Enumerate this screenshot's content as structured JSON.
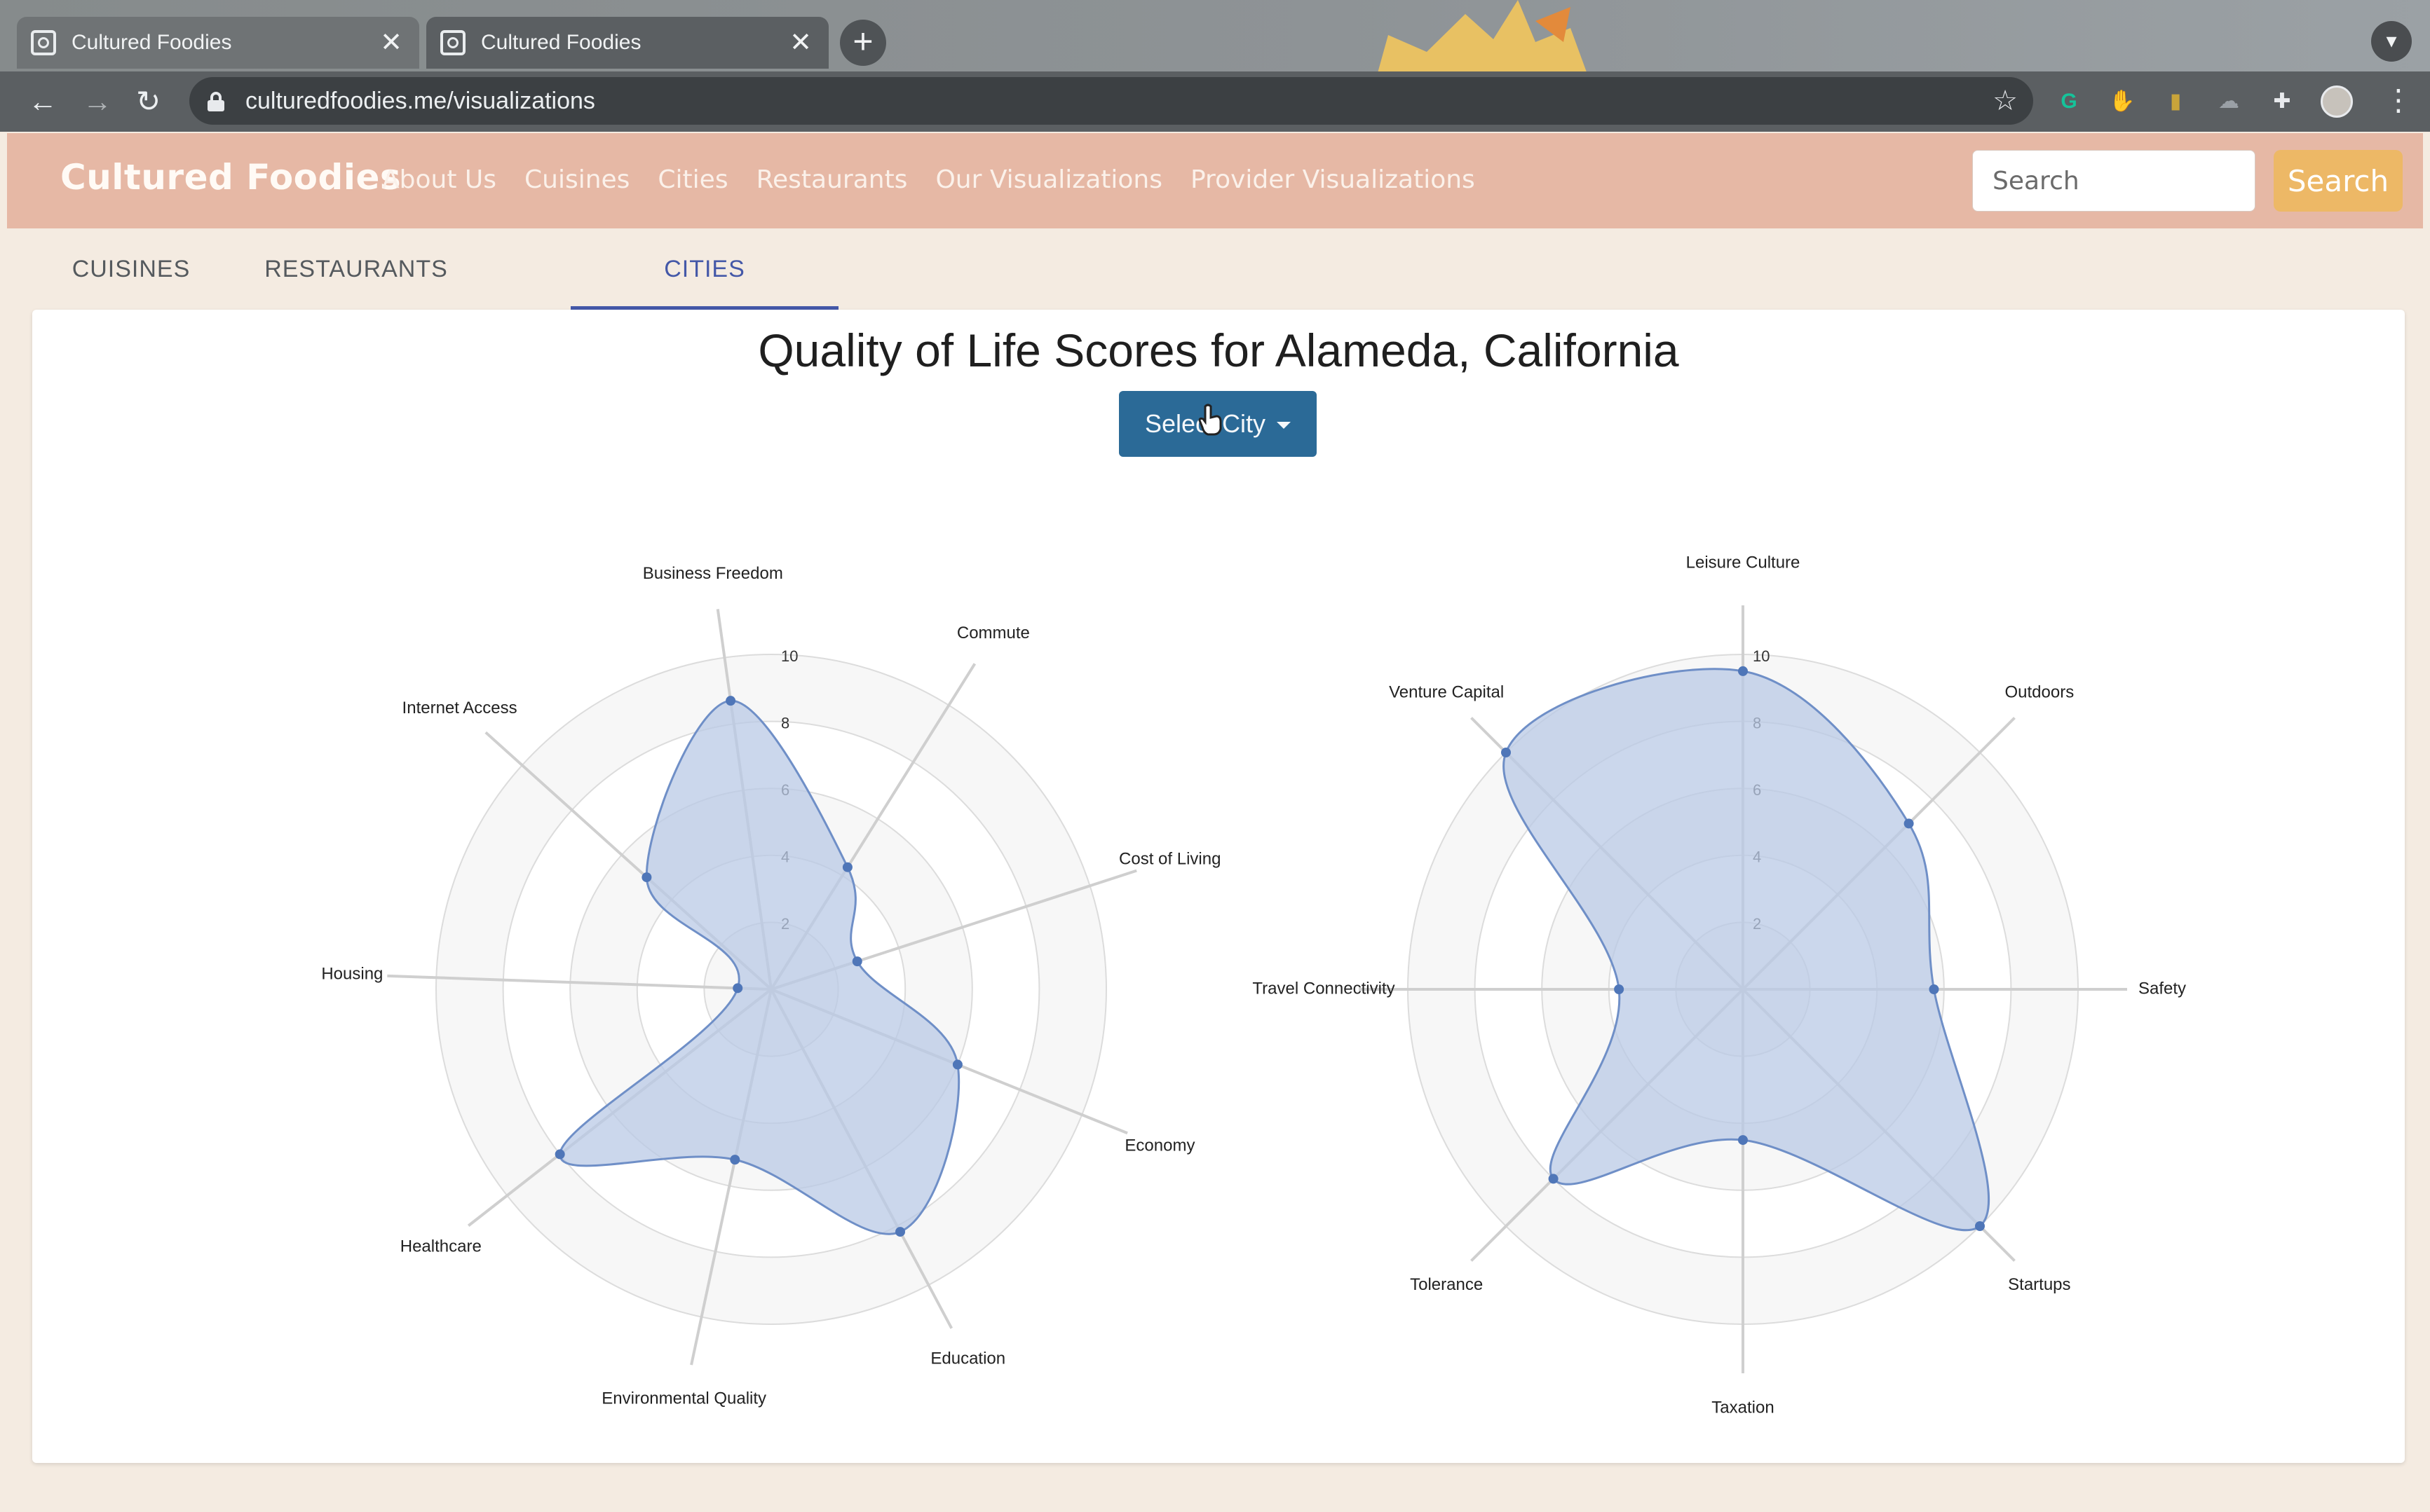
{
  "browser": {
    "tabs": [
      {
        "title": "Cultured Foodies",
        "close": "✕"
      },
      {
        "title": "Cultured Foodies",
        "close": "✕"
      }
    ],
    "new_tab": "+",
    "url": "culturedfoodies.me/visualizations",
    "nav": {
      "back": "←",
      "forward": "→",
      "reload": "↻",
      "star": "☆",
      "menu": "⋮"
    },
    "extensions": [
      {
        "icon": "grammarly-icon",
        "glyph": "G",
        "color": "#15c39a"
      },
      {
        "icon": "stop-extension-icon",
        "glyph": "✋",
        "color": "#d9442e"
      },
      {
        "icon": "highlighter-extension-icon",
        "glyph": "▮",
        "color": "#c9a43a"
      },
      {
        "icon": "cloud-extension-icon",
        "glyph": "☁",
        "color": "#9aa0a6"
      },
      {
        "icon": "puzzle-extensions-icon",
        "glyph": "✚",
        "color": "#e8eaed"
      }
    ]
  },
  "site": {
    "brand": "Cultured Foodies",
    "nav_links": [
      "About Us",
      "Cuisines",
      "Cities",
      "Restaurants",
      "Our Visualizations",
      "Provider Visualizations"
    ],
    "search_placeholder": "Search",
    "search_button": "Search"
  },
  "vis_tabs": [
    "CUISINES",
    "RESTAURANTS",
    "CITIES"
  ],
  "active_tab": "CITIES",
  "card": {
    "title": "Quality of Life Scores for Alameda, California",
    "select_button": "Select City"
  },
  "colors": {
    "accent": "#4458a8",
    "fill": "#b9cae6",
    "stroke": "#6f8fc7",
    "point": "#4f76b8"
  },
  "chart_data": [
    {
      "type": "radar",
      "title": "",
      "range": [
        0,
        10
      ],
      "ticks": [
        2,
        4,
        6,
        8,
        10
      ],
      "categories": [
        "Business Freedom",
        "Commute",
        "Cost of Living",
        "Economy",
        "Education",
        "Environmental Quality",
        "Healthcare",
        "Housing",
        "Internet Access"
      ],
      "values": [
        8.7,
        4.3,
        2.7,
        6.0,
        8.2,
        5.2,
        8.0,
        1.0,
        5.0
      ]
    },
    {
      "type": "radar",
      "title": "",
      "range": [
        0,
        10
      ],
      "ticks": [
        2,
        4,
        6,
        8,
        10
      ],
      "categories": [
        "Leisure Culture",
        "Outdoors",
        "Safety",
        "Startups",
        "Taxation",
        "Tolerance",
        "Travel Connectivity",
        "Venture Capital"
      ],
      "values": [
        9.5,
        7.0,
        5.7,
        10.0,
        4.5,
        8.0,
        3.7,
        10.0
      ]
    }
  ]
}
